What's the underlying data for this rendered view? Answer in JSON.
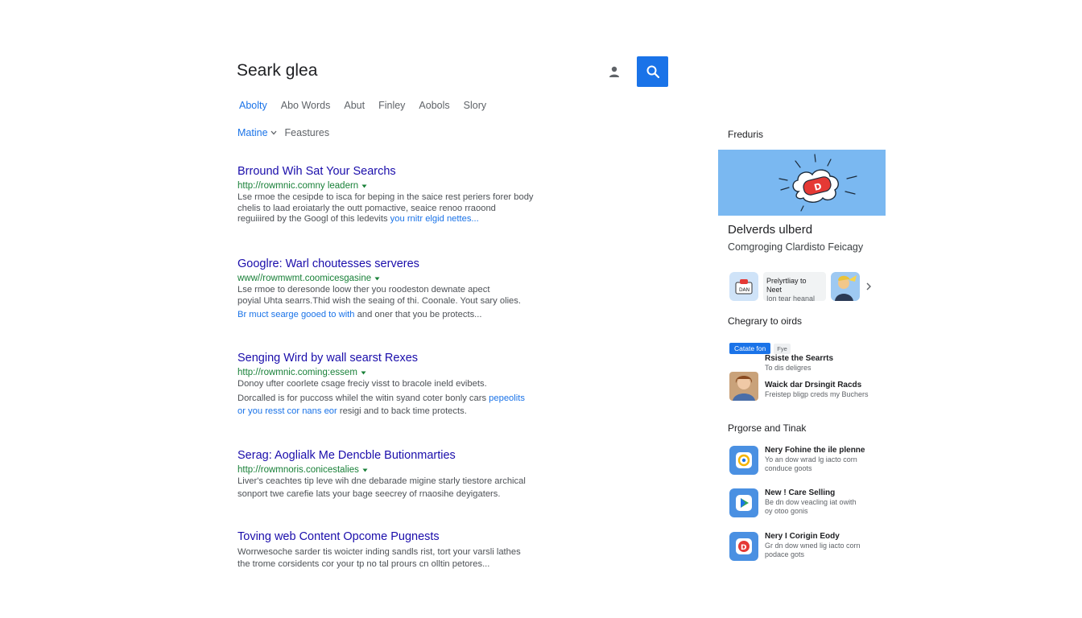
{
  "search": {
    "query": "Seark glea"
  },
  "tabs": [
    "Abolty",
    "Abo Words",
    "Abut",
    "Finley",
    "Aobols",
    "Slory"
  ],
  "filters": {
    "selected": "Matine",
    "other": "Feastures"
  },
  "results": [
    {
      "title": "Brround Wih Sat Your Searchs",
      "url": "http://rowmnic.comny leadern",
      "lines": [
        "Lse rmoe the cesipde to isca for beping in the saice rest periers forer body",
        "chelis to laad eroiatarly the outt pomactive, seaice renoo rraoond"
      ],
      "last_plain": "reguiiired by the Googl of this ledevits ",
      "last_link": "you rnitr elgid nettes..."
    },
    {
      "title": "Googlre: Warl choutesses serveres",
      "url": "www//rowmwmt.coomicesgasine",
      "lines": [
        "Lse rmoe to deresonde loow ther you roodeston dewnate apect",
        "poyial Uhta searrs.Thid wish the seaing of thi. Coonale. Yout sary olies."
      ],
      "last_link": "Br muct searge gooed to with",
      "last_plain": " and oner that you be protects..."
    },
    {
      "title": "Senging Wird by wall searst Rexes",
      "url": "http://rowmnic.coming:essem",
      "lines": [
        "Donoy ufter coorlete csage freciy visst to bracole ineld evibets."
      ],
      "extra_plain": "Dorcalled is for puccoss whilel the witin syand coter bonly cars ",
      "extra_link": "pepeolits",
      "last_link": "or you resst cor nans eor",
      "last_plain": " resigi and to back time protects."
    },
    {
      "title": "Serag: Aoglialk Me Dencble Butionmarties",
      "url": "http://rowmnoris.conicestalies",
      "lines": [
        "Liver's ceachtes tip leve wih dne debarade migine starly tiestore archical",
        "sonport twe carefie lats your bage seecrey of rnaosihe deyigaters."
      ]
    },
    {
      "title": "Toving web Content Opcome Pugnests",
      "lines": [
        "Worrwesoche sarder tis woicter inding sandls rist, tort your varsli lathes",
        "the trome corsidents cor your tp no tal prours cn olltin petores..."
      ]
    }
  ],
  "sidebar": {
    "heading": "Freduris",
    "title": "Delverds ulberd",
    "subtitle": "Comgroging Clardisto Feicagy",
    "chip": {
      "line1": "Prelyrtliay to Neet",
      "line2": "Ion tear heanal"
    },
    "section1": {
      "heading": "Chegrary to oirds",
      "badge": "Catate fon",
      "badge2": "Fye",
      "item1": {
        "title": "Rsiste the Searrts",
        "sub": "To dis deligres"
      },
      "item2": {
        "title": "Waick dar Drsingit Racds",
        "sub": "Freistep bligp creds my Buchers"
      }
    },
    "section2": {
      "heading": "Prgorse and Tinak",
      "items": [
        {
          "title": "Nery Fohine the ile plenne",
          "sub1": "Yo an dow wrad lg iacto corn",
          "sub2": "conduce goots"
        },
        {
          "title": "New ! Care Selling",
          "sub1": "Be dn dow veacling iat owith",
          "sub2": "oy otoo gonis"
        },
        {
          "title": "Nery I Corigin Eody",
          "sub1": "Gr dn dow wned lig iacto corn",
          "sub2": "podace gots"
        }
      ]
    }
  },
  "colors": {
    "accent": "#1a73e8",
    "link": "#1a0dab",
    "url": "#188038"
  }
}
